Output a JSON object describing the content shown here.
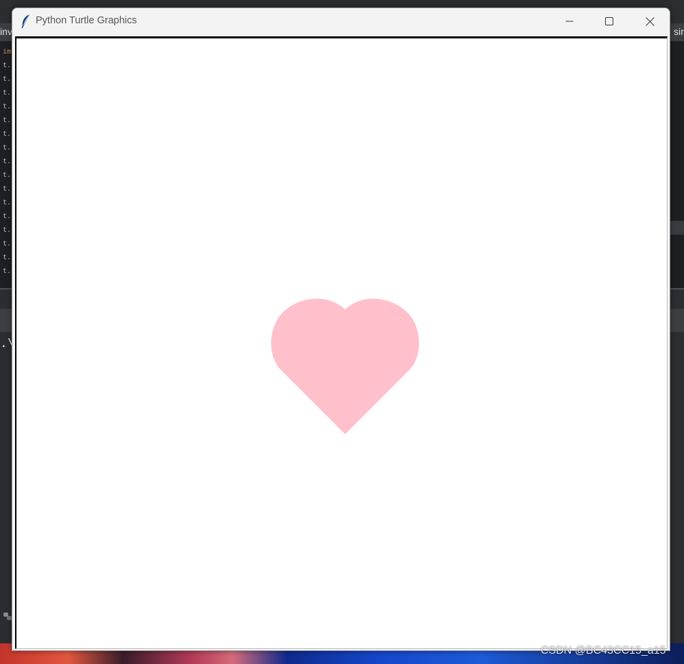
{
  "window": {
    "title": "Python Turtle Graphics",
    "icon": "feather-icon",
    "controls": {
      "minimize": "minimize-icon",
      "maximize": "maximize-icon",
      "close": "close-icon"
    }
  },
  "canvas": {
    "background": "#ffffff",
    "shape": {
      "type": "heart",
      "fill": "#ffc0cb"
    }
  },
  "background_ide": {
    "tab_left": "inv",
    "tab_right": "sir",
    "code_lines": [
      "im",
      "t.",
      "t.",
      "t.",
      "t.",
      "t.",
      "t.",
      "t.",
      "t.",
      "t.",
      "t.",
      "t.",
      "t.",
      "t.",
      "t.",
      "t.",
      "t."
    ],
    "terminal_text": ".\\"
  },
  "watermark": "CSDN @BC43CC15_a15"
}
